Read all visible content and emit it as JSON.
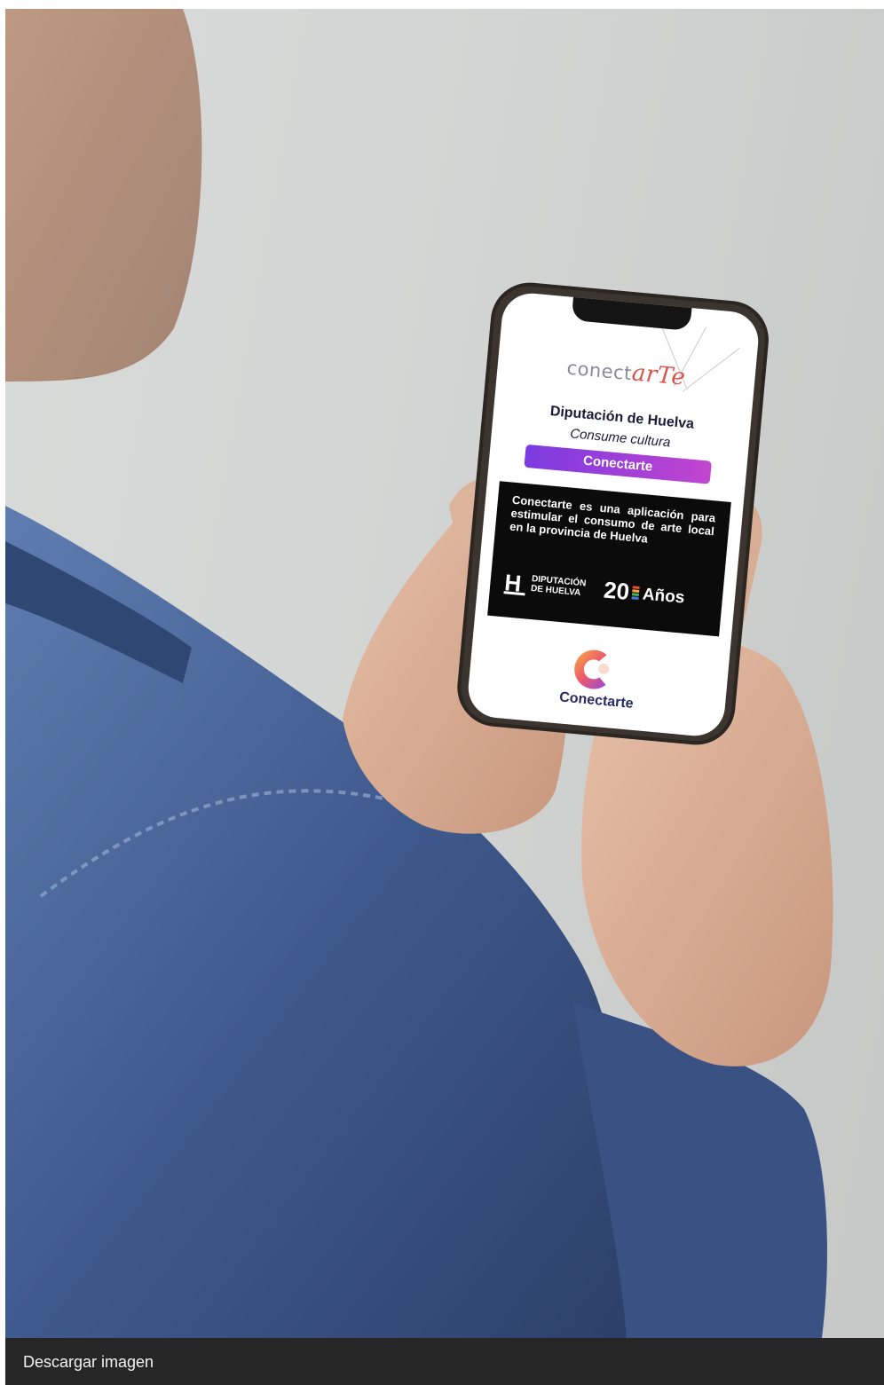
{
  "photo": {
    "alt": "",
    "screen": {
      "logo_prefix": "conect",
      "logo_accent": "arTe",
      "org_title": "Diputación de Huelva",
      "tagline": "Consume cultura",
      "cta_label": "Conectarte",
      "info_text": "Conectarte es una aplicación para estimular el consumo de arte local en la provincia de Huelva",
      "partner_mark": "H",
      "partner_line1": "DIPUTACIÓN",
      "partner_line2": "DE HUELVA",
      "anniversary_number": "20",
      "anniversary_word": "Años",
      "app_name": "Conectarte"
    }
  },
  "caption": {
    "download_label": "Descargar imagen"
  },
  "colors": {
    "cta_start": "#7b3be0",
    "cta_end": "#c246cf",
    "caption_bg": "#262626"
  }
}
